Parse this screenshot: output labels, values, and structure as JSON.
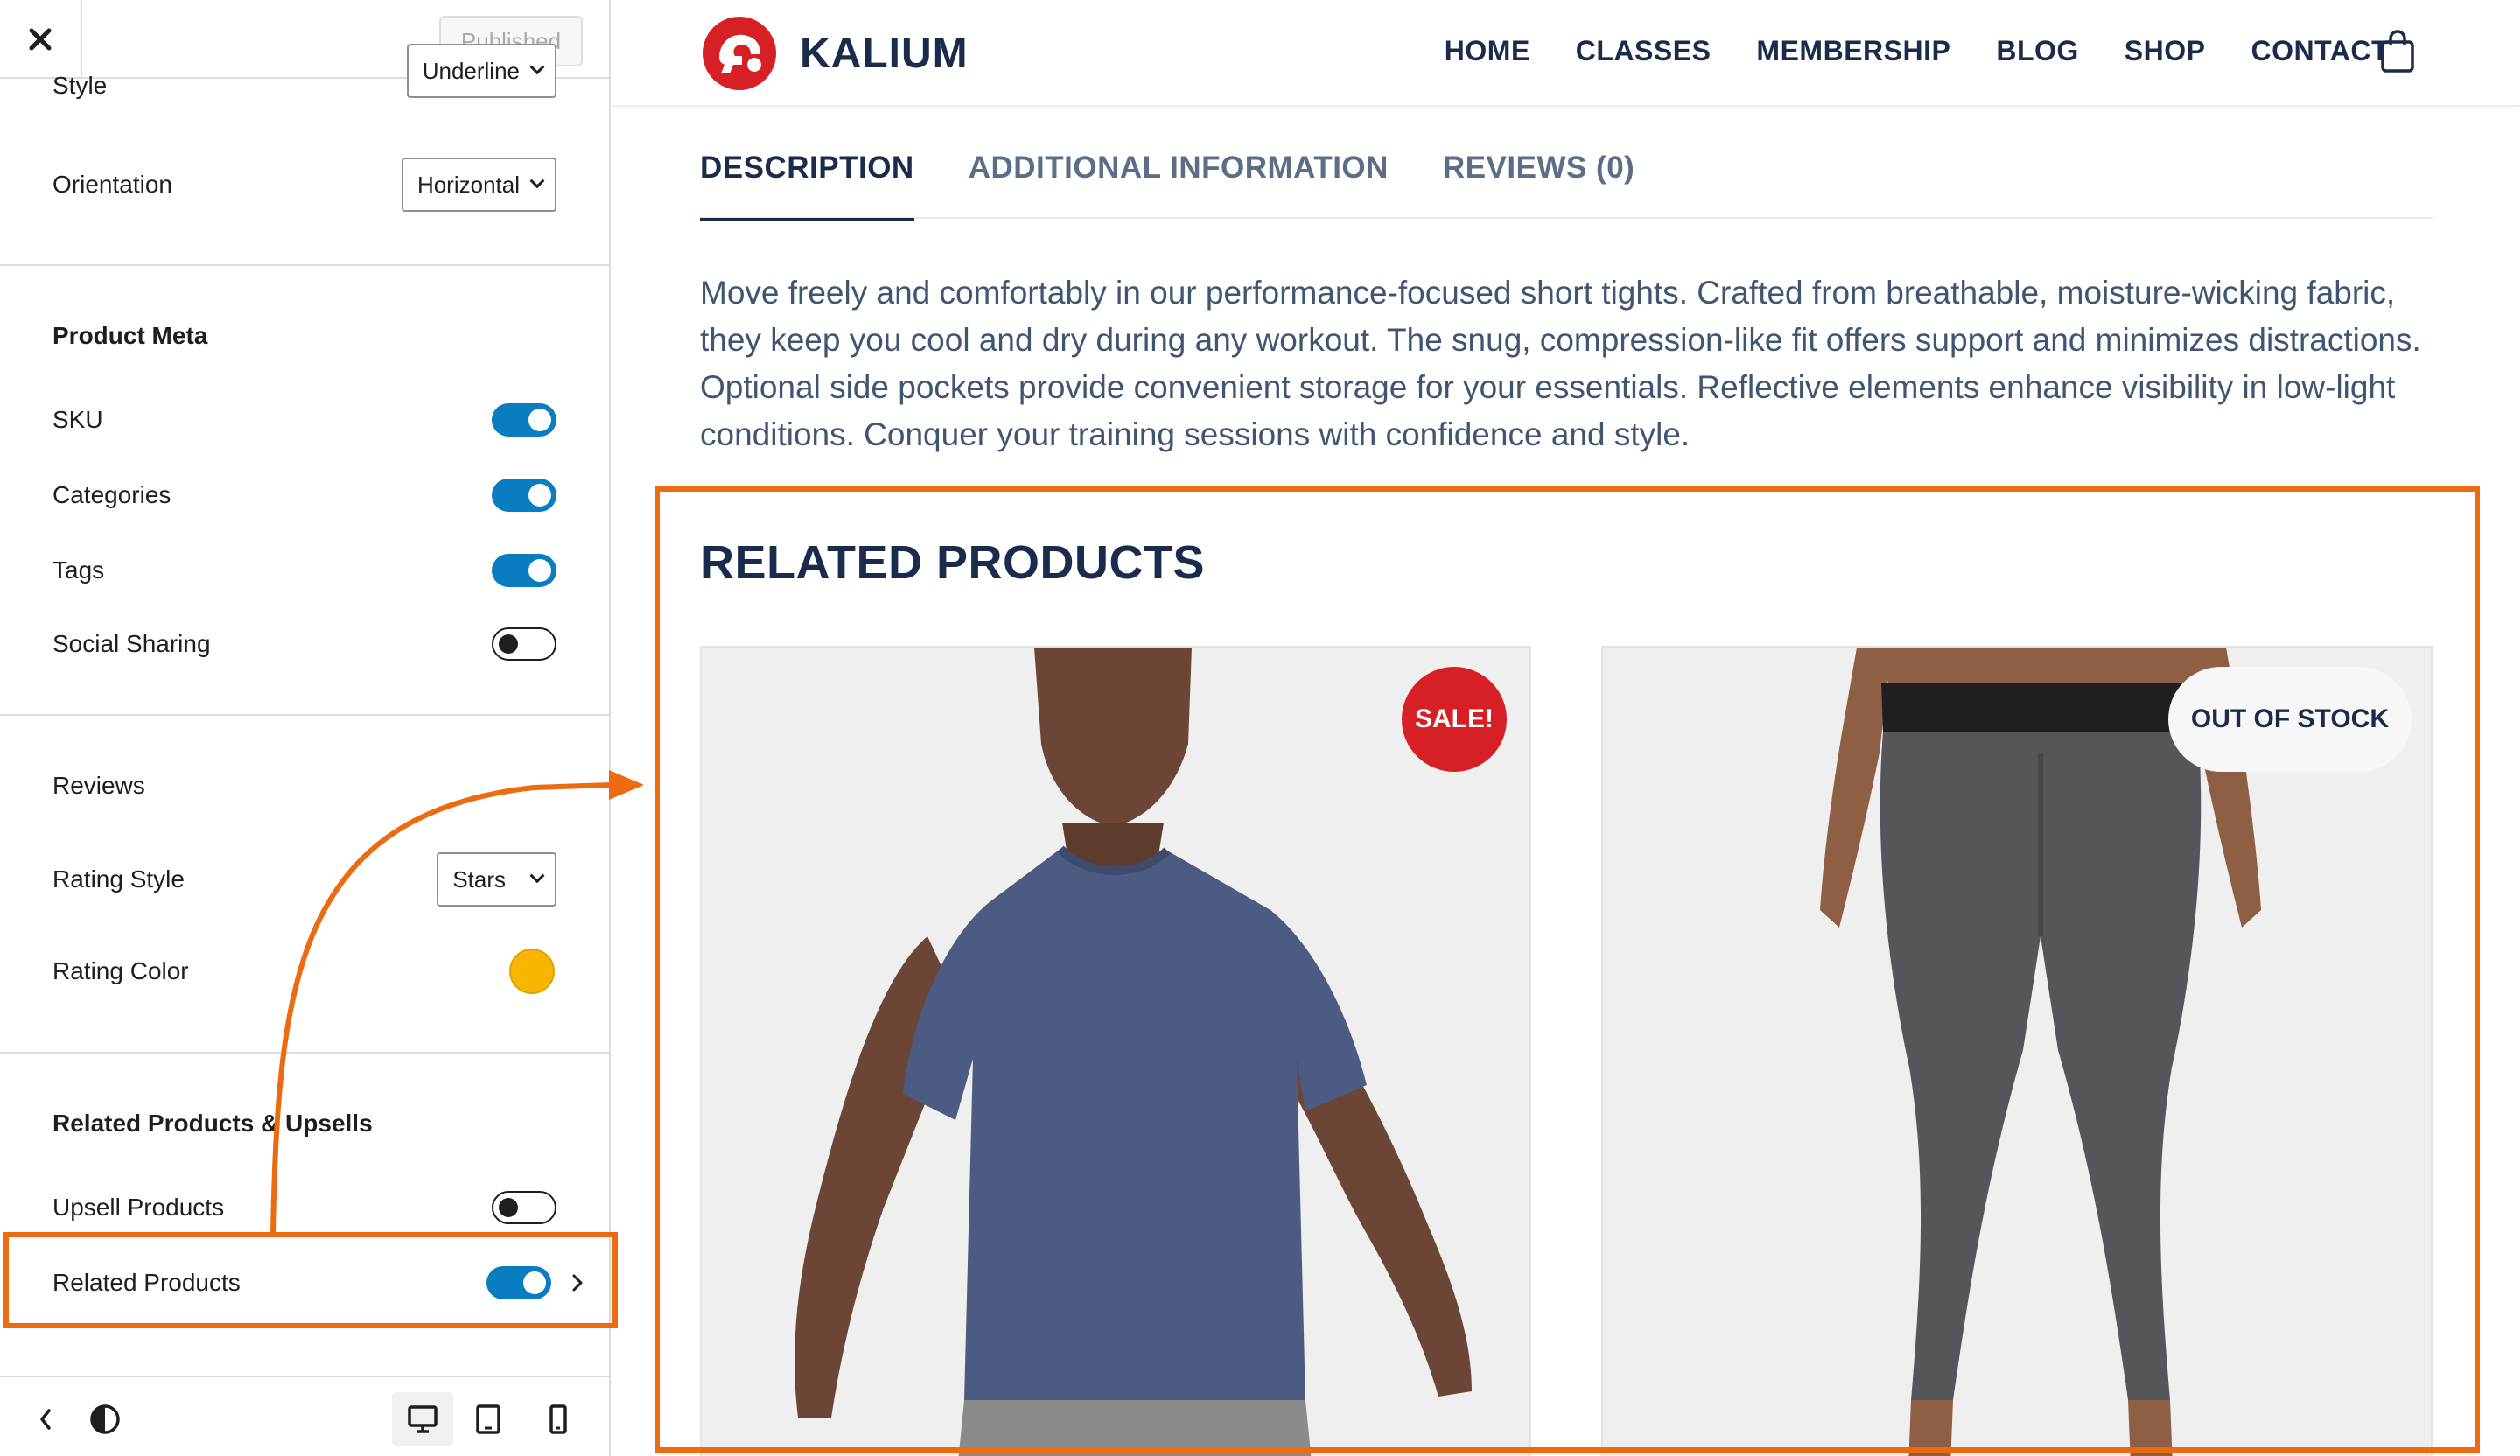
{
  "sidebar": {
    "publish_label": "Published",
    "style": {
      "label": "Style",
      "value": "Underline"
    },
    "orientation": {
      "label": "Orientation",
      "value": "Horizontal"
    },
    "product_meta": {
      "heading": "Product Meta",
      "items": [
        {
          "label": "SKU",
          "enabled": true
        },
        {
          "label": "Categories",
          "enabled": true
        },
        {
          "label": "Tags",
          "enabled": true
        },
        {
          "label": "Social Sharing",
          "enabled": false
        }
      ]
    },
    "reviews": {
      "heading": "Reviews",
      "rating_style": {
        "label": "Rating Style",
        "value": "Stars"
      },
      "rating_color": {
        "label": "Rating Color",
        "color": "#f8b500"
      }
    },
    "related_upsells": {
      "heading": "Related Products & Upsells",
      "upsell": {
        "label": "Upsell Products",
        "enabled": false
      },
      "related": {
        "label": "Related Products",
        "enabled": true
      }
    }
  },
  "site": {
    "logo_text": "KALIUM",
    "brand_color": "#d71f26",
    "nav": [
      "HOME",
      "CLASSES",
      "MEMBERSHIP",
      "BLOG",
      "SHOP",
      "CONTACT"
    ]
  },
  "product": {
    "tabs": [
      "DESCRIPTION",
      "ADDITIONAL INFORMATION",
      "REVIEWS (0)"
    ],
    "active_tab": "DESCRIPTION",
    "description": "Move freely and comfortably in our performance-focused short tights. Crafted from breathable, moisture-wicking fabric, they keep you cool and dry during any workout. The snug, compression-like fit offers support and minimizes distractions. Optional side pockets provide convenient storage for your essentials. Reflective elements enhance visibility in low-light conditions. Conquer your training sessions with confidence and style.",
    "related_title": "RELATED PRODUCTS",
    "related": [
      {
        "image": "man in blue t-shirt",
        "badge": "SALE!"
      },
      {
        "image": "grey compression tights",
        "badge": "OUT OF STOCK"
      }
    ]
  },
  "annotation_color": "#ec6a10"
}
